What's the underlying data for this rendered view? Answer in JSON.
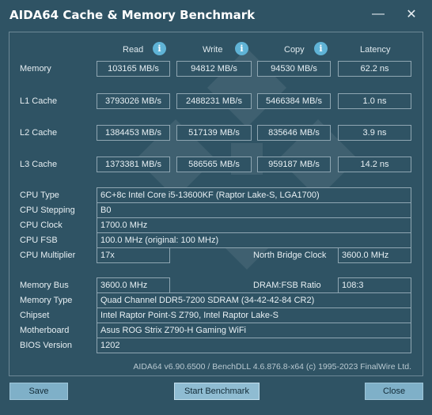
{
  "window": {
    "title": "AIDA64 Cache & Memory Benchmark",
    "minimize_glyph": "—",
    "close_glyph": "✕"
  },
  "columns": {
    "read": "Read",
    "write": "Write",
    "copy": "Copy",
    "latency": "Latency",
    "info_glyph": "i"
  },
  "bench": {
    "memory": {
      "label": "Memory",
      "read": "103165 MB/s",
      "write": "94812 MB/s",
      "copy": "94530 MB/s",
      "latency": "62.2 ns"
    },
    "l1": {
      "label": "L1 Cache",
      "read": "3793026 MB/s",
      "write": "2488231 MB/s",
      "copy": "5466384 MB/s",
      "latency": "1.0 ns"
    },
    "l2": {
      "label": "L2 Cache",
      "read": "1384453 MB/s",
      "write": "517139 MB/s",
      "copy": "835646 MB/s",
      "latency": "3.9 ns"
    },
    "l3": {
      "label": "L3 Cache",
      "read": "1373381 MB/s",
      "write": "586565 MB/s",
      "copy": "959187 MB/s",
      "latency": "14.2 ns"
    }
  },
  "cpu": {
    "type_label": "CPU Type",
    "type": "6C+8c Intel Core i5-13600KF  (Raptor Lake-S, LGA1700)",
    "stepping_label": "CPU Stepping",
    "stepping": "B0",
    "clock_label": "CPU Clock",
    "clock": "1700.0 MHz",
    "fsb_label": "CPU FSB",
    "fsb": "100.0 MHz  (original: 100 MHz)",
    "multiplier_label": "CPU Multiplier",
    "multiplier": "17x",
    "nb_clock_label": "North Bridge Clock",
    "nb_clock": "3600.0 MHz"
  },
  "memory": {
    "bus_label": "Memory Bus",
    "bus": "3600.0 MHz",
    "dram_fsb_label": "DRAM:FSB Ratio",
    "dram_fsb": "108:3",
    "type_label": "Memory Type",
    "type": "Quad Channel DDR5-7200 SDRAM  (34-42-42-84 CR2)",
    "chipset_label": "Chipset",
    "chipset": "Intel Raptor Point-S Z790, Intel Raptor Lake-S",
    "motherboard_label": "Motherboard",
    "motherboard": "Asus ROG Strix Z790-H Gaming WiFi",
    "bios_label": "BIOS Version",
    "bios": "1202"
  },
  "footer": "AIDA64 v6.90.6500 / BenchDLL 4.6.876.8-x64  (c) 1995-2023 FinalWire Ltd.",
  "buttons": {
    "save": "Save",
    "start": "Start Benchmark",
    "close": "Close"
  },
  "colors": {
    "background": "#2f5364",
    "accent": "#5fb3d6",
    "button": "#7fb0c8"
  }
}
